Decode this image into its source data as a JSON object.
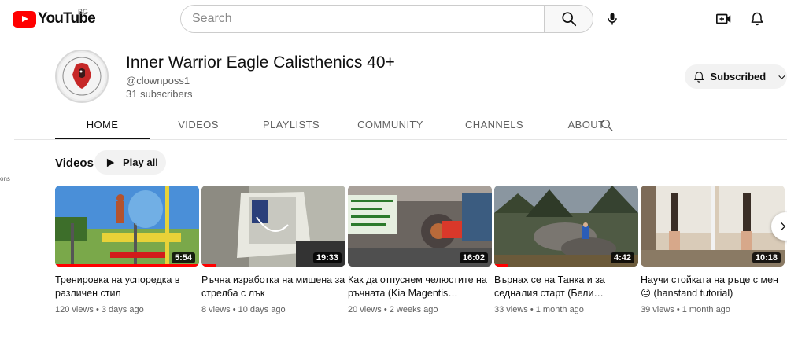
{
  "masthead": {
    "logo_text": "YouTube",
    "region": "BG",
    "search_placeholder": "Search"
  },
  "channel": {
    "name": "Inner Warrior Eagle Calisthenics 40+",
    "handle": "@clownposs1",
    "subscribers": "31 subscribers",
    "subscribe_label": "Subscribed"
  },
  "tabs": [
    {
      "label": "HOME",
      "active": true
    },
    {
      "label": "VIDEOS",
      "active": false
    },
    {
      "label": "PLAYLISTS",
      "active": false
    },
    {
      "label": "COMMUNITY",
      "active": false
    },
    {
      "label": "CHANNELS",
      "active": false
    },
    {
      "label": "ABOUT",
      "active": false
    }
  ],
  "sidebar_fragment": "ons",
  "shelf": {
    "title": "Videos",
    "play_all_label": "Play all"
  },
  "videos": [
    {
      "title": "Тренировка на успоредка в различен стил",
      "duration": "5:54",
      "meta": "120 views • 3 days ago",
      "watched": 1.0
    },
    {
      "title": "Ръчна изработка на мишена за стрелба с лък",
      "duration": "19:33",
      "meta": "8 views • 10 days ago",
      "watched": 0.1
    },
    {
      "title": "Как да отпуснем челюстите на ръчната (Kia Magentis…",
      "duration": "16:02",
      "meta": "20 views • 2 weeks ago",
      "watched": 0.0
    },
    {
      "title": "Върнах се на Танка и за седналия старт (Бели…",
      "duration": "4:42",
      "meta": "33 views • 1 month ago",
      "watched": 0.1
    },
    {
      "title": "Научи стойката на ръце с мен 😐 (hanstand tutorial)",
      "duration": "10:18",
      "meta": "39 views • 1 month ago",
      "watched": 0.0
    }
  ],
  "colors": {
    "brand_red": "#ff0000",
    "chip_bg": "#f2f2f2",
    "secondary_text": "#606060"
  }
}
